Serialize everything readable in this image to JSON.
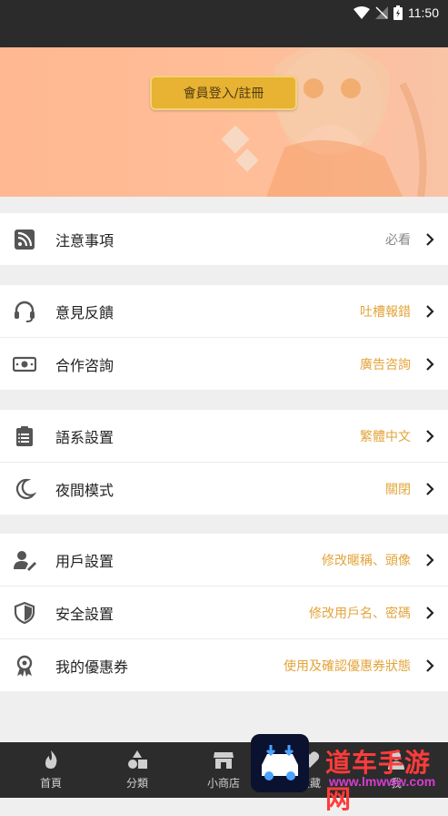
{
  "status_bar": {
    "time": "11:50"
  },
  "banner": {
    "login_label": "會員登入/註冊"
  },
  "groups": [
    [
      {
        "label": "注意事項",
        "value": "必看"
      }
    ],
    [
      {
        "label": "意見反饋",
        "value": "吐槽報錯"
      },
      {
        "label": "合作咨詢",
        "value": "廣告咨詢"
      }
    ],
    [
      {
        "label": "語系設置",
        "value": "繁體中文"
      },
      {
        "label": "夜間模式",
        "value": "關閉"
      }
    ],
    [
      {
        "label": "用戶設置",
        "value": "修改暱稱、頭像"
      },
      {
        "label": "安全設置",
        "value": "修改用戶名、密碼"
      },
      {
        "label": "我的優惠券",
        "value": "使用及確認優惠券狀態"
      }
    ]
  ],
  "tabbar": [
    {
      "label": "首頁",
      "icon": "flame-icon"
    },
    {
      "label": "分類",
      "icon": "shapes-icon"
    },
    {
      "label": "小商店",
      "icon": "shop-icon"
    },
    {
      "label": "收藏",
      "icon": "heart-icon"
    },
    {
      "label": "我",
      "icon": "user-icon"
    }
  ],
  "watermark": {
    "text": "道车手游网",
    "url": "www.lmwww.com"
  },
  "colors": {
    "accent": "#e3a43a",
    "button": "#e8b333",
    "banner": "#ffbd98",
    "tabbar": "#2c2c2c"
  }
}
